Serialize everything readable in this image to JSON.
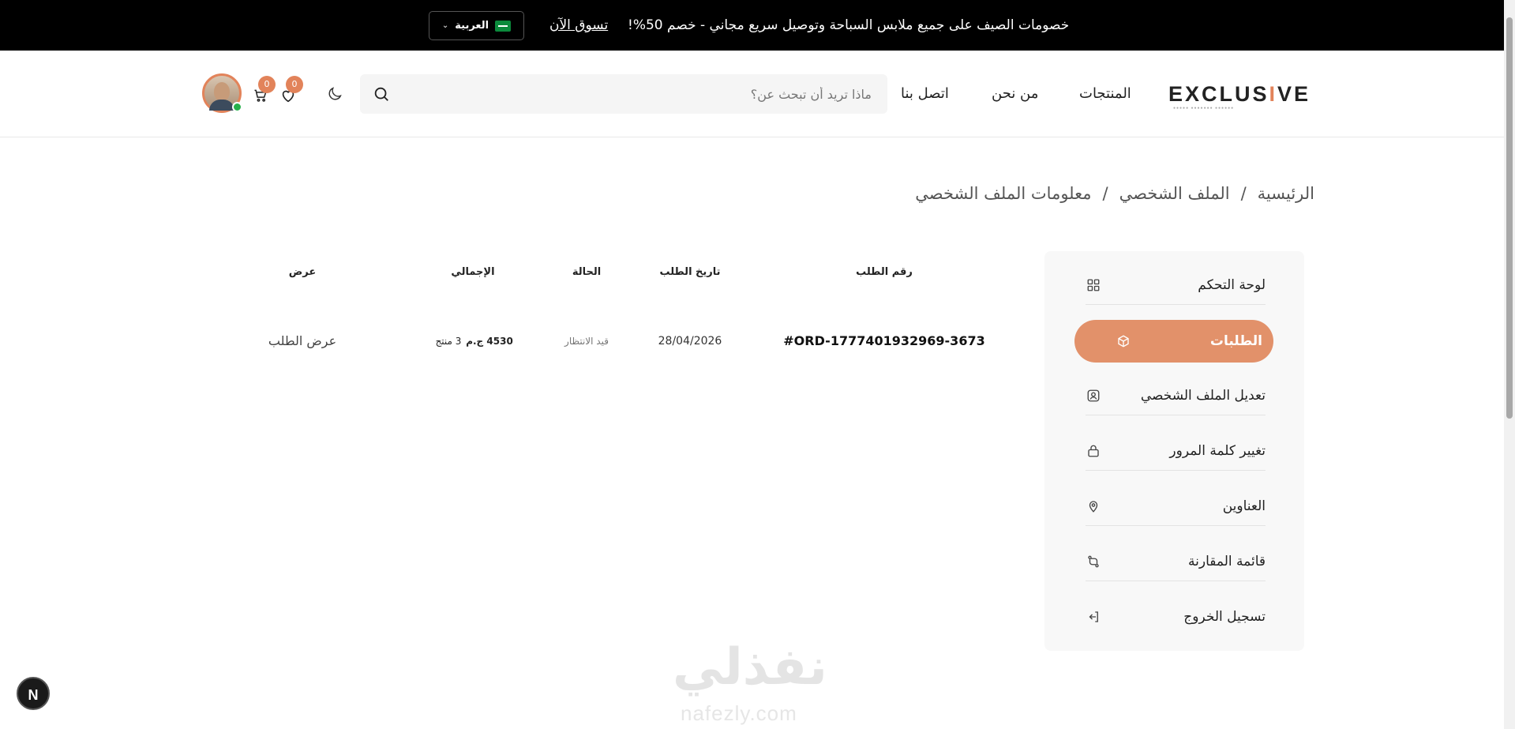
{
  "announcement": {
    "message": "خصومات الصيف على جميع ملابس السباحة وتوصيل سريع مجاني - خصم 50%!",
    "shop_link": "تسوق الآن",
    "language": "العربية"
  },
  "header": {
    "logo_text": "EXCLUSIVE",
    "nav": {
      "products": "المنتجات",
      "about": "من نحن",
      "contact": "اتصل بنا"
    },
    "search": {
      "placeholder": "ماذا تريد أن تبحث عن؟",
      "value": ""
    },
    "wishlist_count": "0",
    "cart_count": "0"
  },
  "breadcrumb": {
    "home": "الرئيسية",
    "separator": "/",
    "profile": "الملف الشخصي",
    "current": "معلومات الملف الشخصي"
  },
  "sidebar": {
    "items": [
      {
        "label": "لوحة التحكم",
        "icon": "dashboard-icon"
      },
      {
        "label": "الطلبات",
        "icon": "box-icon"
      },
      {
        "label": "تعديل الملف الشخصي",
        "icon": "user-square-icon"
      },
      {
        "label": "تغيير كلمة المرور",
        "icon": "lock-icon"
      },
      {
        "label": "العناوين",
        "icon": "location-pin-icon"
      },
      {
        "label": "قائمة المقارنة",
        "icon": "compare-icon"
      },
      {
        "label": "تسجيل الخروج",
        "icon": "logout-icon"
      }
    ]
  },
  "orders": {
    "columns": {
      "number": "رقم الطلب",
      "date": "تاريخ الطلب",
      "status": "الحالة",
      "total": "الإجمالي",
      "view": "عرض"
    },
    "rows": [
      {
        "number": "#ORD-1777401932969-3673",
        "date": "28/04/2026",
        "status": "قيد الانتظار",
        "total": "4530 ج.م",
        "items": "3 منتج",
        "view": "عرض الطلب"
      }
    ]
  },
  "watermark": {
    "arabic": "نفذلي",
    "latin": "nafezly.com"
  },
  "dev_indicator": "N",
  "colors": {
    "accent": "#e2835a",
    "active_item": "#e2916a",
    "topbar": "#000000",
    "online": "#27b04b"
  }
}
